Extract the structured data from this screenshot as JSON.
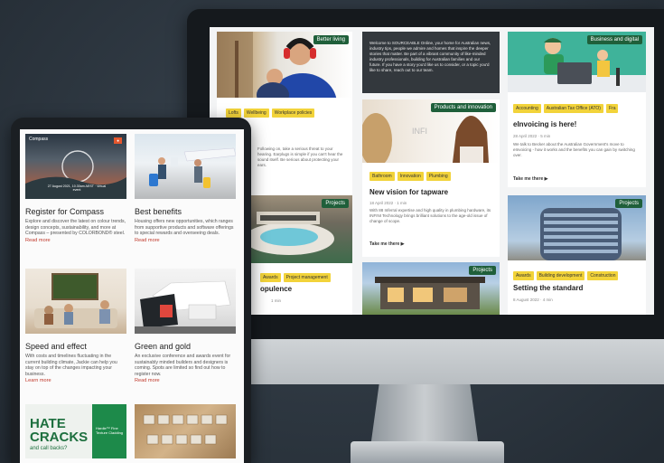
{
  "monitor": {
    "cards": [
      {
        "badge": "Better living",
        "tags": [
          "Lofts",
          "Wellbeing",
          "Workplace policies"
        ],
        "text": "Following on, take a serious threat to your hearing. Earplugs is simple if you can't hear the sound itself. Be serious about protecting your ears."
      },
      {
        "promo": "Welcome to SOURCEABLE Online, your home for Australian news, industry tips, people we admire and homes that inspire the deeper stories that matter. Be part of a vibrant community of like-minded industry professionals, building for Australian families and our future. If you have a story you'd like us to consider, or a topic you'd like to share, reach out to our team."
      },
      {
        "badge": "Business and digital",
        "tags": [
          "Accounting",
          "Australian Tax Office (ATO)",
          "Fra"
        ],
        "title": "eInvoicing is here!",
        "meta": "28 April 2022  ·  5 min",
        "text": "We talk to Becker about the Australian Government's move to eInvoicing - how it works and the benefits you can gain by switching over.",
        "link": "Take me there"
      },
      {
        "badge": "Products and innovation",
        "tags": [
          "Bathroom",
          "Innovation",
          "Plumbing"
        ],
        "title": "New vision for tapware",
        "meta": "18 April 2022  ·  1 min",
        "text": "With 88 Inferral expertise and high quality in plumbing hardware, its INFINI Technology brings brilliant solutions to the age-old issue of change of scope.",
        "link": "Take me there"
      },
      {
        "badge": "Projects",
        "tags": [
          "Awards",
          "Project management"
        ],
        "title": "opulence",
        "meta": "1 min"
      },
      {
        "badge": "Projects"
      },
      {
        "badge": "Projects",
        "tags": [
          "Awards",
          "Building development",
          "Construction"
        ],
        "title": "Setting the standard",
        "meta": "8 August 2022  ·  4 min"
      }
    ]
  },
  "tablet": {
    "cards": [
      {
        "title": "Register for Compass",
        "text": "Explore and discover the latest on colour trends, design concepts, sustainability, and more at Compass – presented by COLORBOND® steel.",
        "link": "Read more",
        "hero_mark": "Compass",
        "hero_date": "27 August 2021, 10.30am AEST · Virtual event"
      },
      {
        "title": "Best benefits",
        "text": "Housing offers new opportunities, which ranges from supportive products and software offerings to special rewards and overseeing deals.",
        "link": "Read more"
      },
      {
        "title": "Speed and effect",
        "text": "With costs and timelines fluctuating in the current building climate, Jackie can help you stay on top of the changes impacting your business.",
        "link": "Learn more"
      },
      {
        "title": "Green and gold",
        "text": "An exclusive conference and awards event for sustainably minded builders and designers is coming. Spots are limited so find out how to register now.",
        "link": "Read more"
      },
      {
        "ad_big": "HATE CRACKS",
        "ad_small": "and call backs?",
        "ad_side": "Hardie™ Fine Texture Cladding"
      }
    ]
  },
  "colors": {
    "badge_green": "#1f5f3a",
    "tag_yellow": "#f2d33a",
    "link_red": "#c0392b",
    "badge_orange": "#e4572e"
  }
}
